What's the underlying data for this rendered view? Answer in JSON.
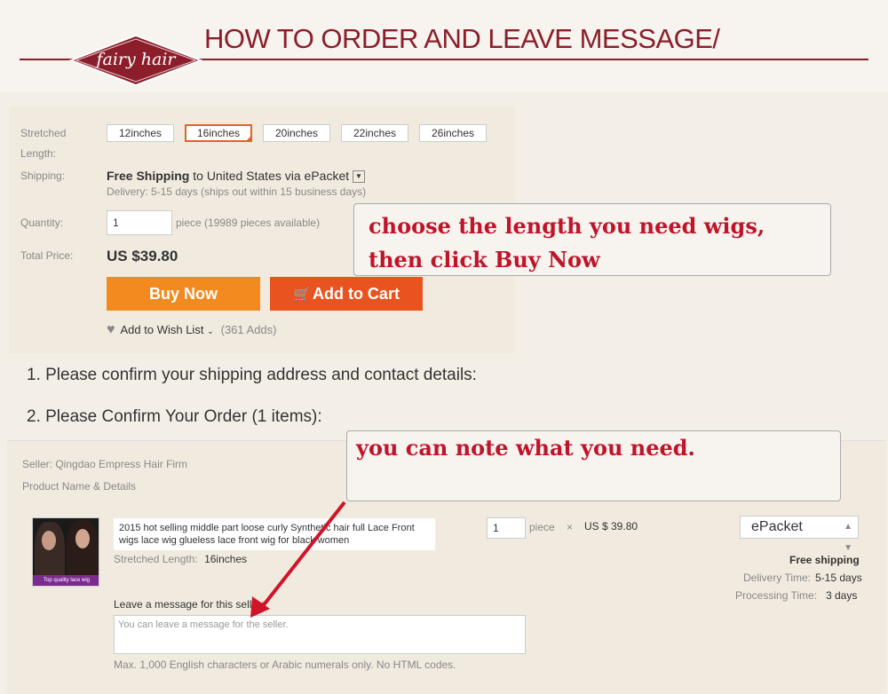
{
  "header": {
    "logo_text": "fairy hair",
    "title": "HOW TO ORDER AND LEAVE MESSAGE/"
  },
  "product": {
    "length_label_1": "Stretched",
    "length_label_2": "Length:",
    "lengths": [
      "12inches",
      "16inches",
      "20inches",
      "22inches",
      "26inches"
    ],
    "selected_length": "16inches",
    "shipping_label": "Shipping:",
    "shipping_free": "Free Shipping",
    "shipping_to": "to",
    "shipping_country": "United States via ePacket",
    "delivery": "Delivery: 5-15 days (ships out within 15 business days)",
    "quantity_label": "Quantity:",
    "quantity_value": "1",
    "pieces_available": "piece (19989 pieces available)",
    "total_label": "Total Price:",
    "total_price": "US $39.80",
    "buy_now": "Buy Now",
    "add_to_cart": "Add to Cart",
    "wish_list": "Add to Wish List",
    "wish_adds": "(361 Adds)"
  },
  "callouts": {
    "first_line1": "choose the length you need wigs,",
    "first_line2": "then click Buy Now",
    "second": "you can note what you need."
  },
  "steps": {
    "step1": "1. Please confirm your shipping address and contact details:",
    "step2": "2. Please Confirm Your Order (1 items):"
  },
  "order": {
    "seller": "Seller: Qingdao Empress Hair Firm",
    "product_details": "Product Name & Details",
    "thumb_caption": "Top quality lace wig",
    "product_name": "2015 hot selling middle part loose curly Synthetic hair full Lace Front wigs lace wig glueless lace front wig for black women",
    "stretched_label": "Stretched Length:",
    "stretched_value": "16inches",
    "qty_value": "1",
    "piece": "piece",
    "times": "×",
    "unit_price": "US $ 39.80",
    "shipping_method": "ePacket",
    "free_shipping": "Free shipping",
    "delivery_label": "Delivery Time:",
    "delivery_value": "5-15 days",
    "processing_label": "Processing Time:",
    "processing_value": "3 days",
    "message_label": "Leave a message for this seller:",
    "message_placeholder": "You can leave a message for the seller.",
    "message_hint": "Max. 1,000 English characters or Arabic numerals only. No HTML codes."
  },
  "colors": {
    "brand": "#8b1e2a",
    "buy_now": "#f28a1f",
    "add_to_cart": "#e8531f",
    "callout_text": "#c0142a"
  }
}
